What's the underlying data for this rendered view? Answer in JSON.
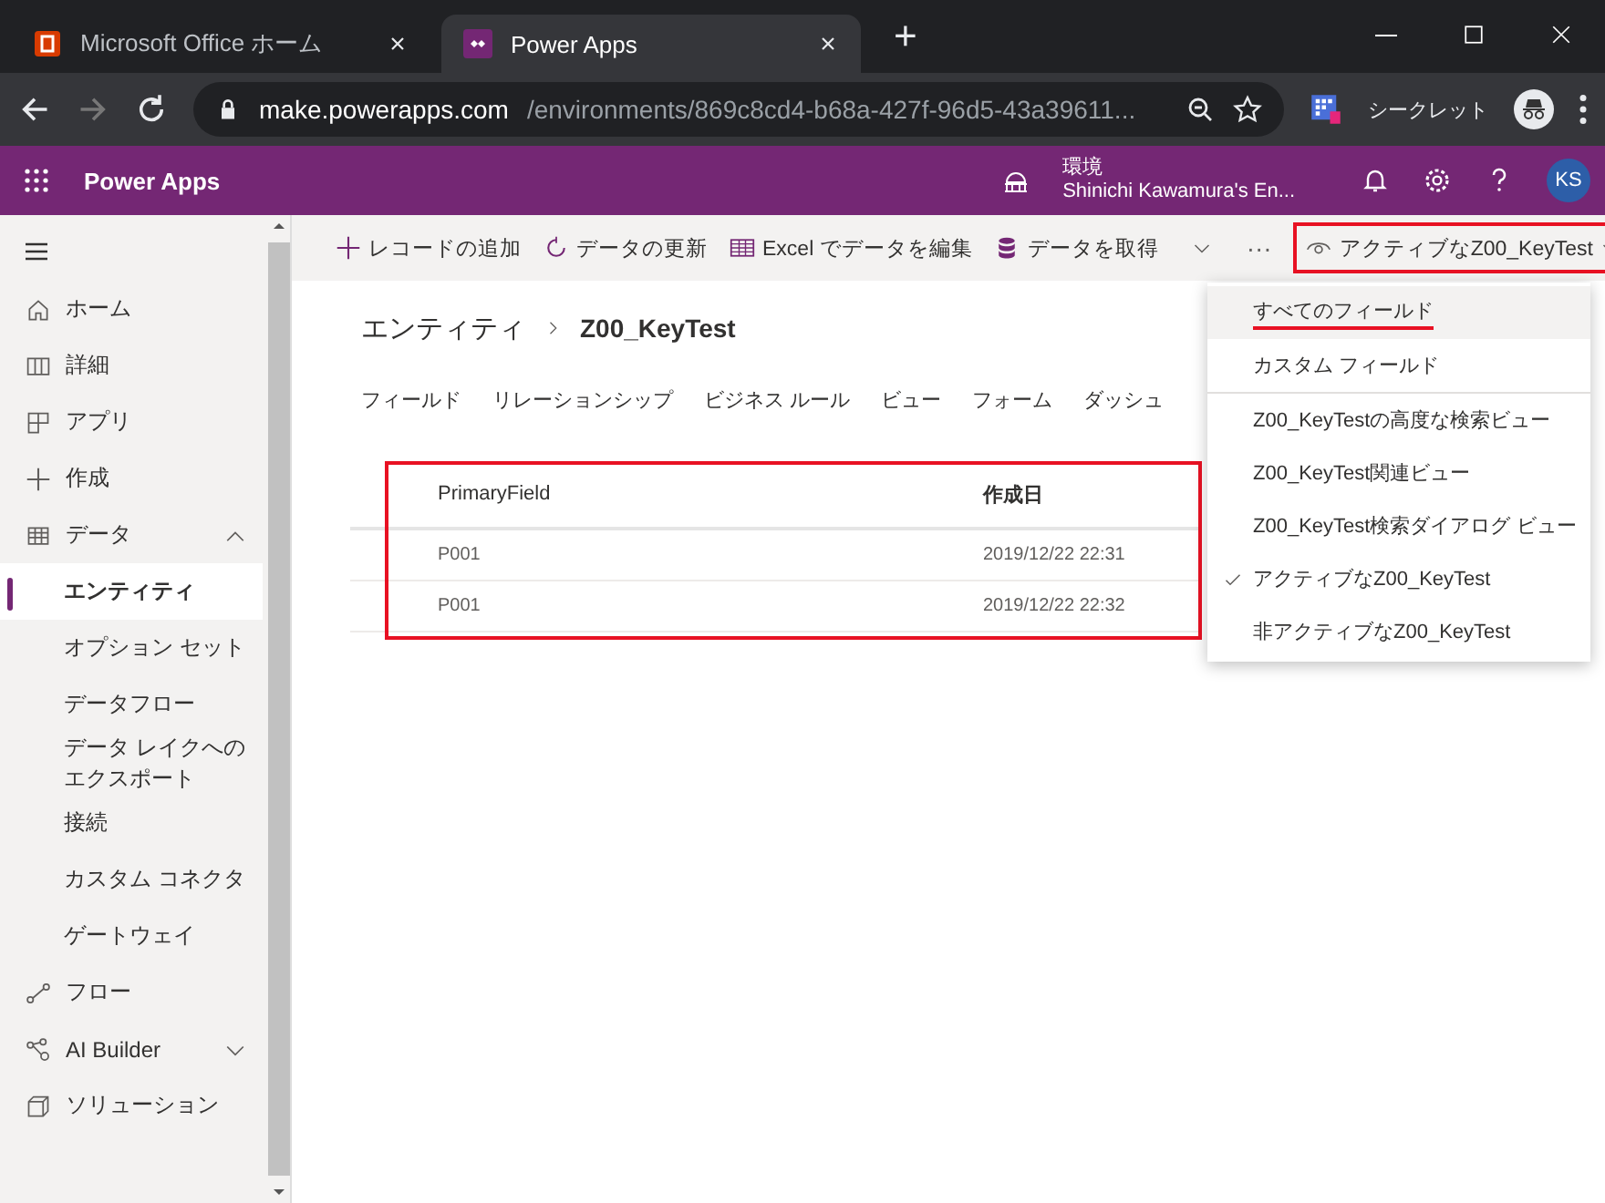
{
  "browser": {
    "tabs": [
      {
        "title": "Microsoft Office ホーム",
        "selected": false,
        "kind": "office"
      },
      {
        "title": "Power Apps",
        "selected": true,
        "kind": "powerapps"
      }
    ],
    "new_tab": "+",
    "url_host": "make.powerapps.com",
    "url_path": "/environments/869c8cd4-b68a-427f-96d5-43a39611...",
    "profile": "シークレット"
  },
  "app_header": {
    "title": "Power Apps",
    "environment_label": "環境",
    "environment": "Shinichi Kawamura's En...",
    "avatar": "KS"
  },
  "sidebar": {
    "items": [
      {
        "label": "ホーム",
        "kind": "home"
      },
      {
        "label": "詳細",
        "kind": "book"
      },
      {
        "label": "アプリ",
        "kind": "apps"
      },
      {
        "label": "作成",
        "kind": "plus"
      },
      {
        "label": "データ",
        "kind": "table",
        "expanded": true,
        "children": [
          {
            "label": "エンティティ",
            "selected": true
          },
          {
            "label": "オプション セット",
            "selected": false
          },
          {
            "label": "データフロー",
            "selected": false
          },
          {
            "label": "データ レイクへのエクスポート",
            "selected": false
          },
          {
            "label": "接続",
            "selected": false
          },
          {
            "label": "カスタム コネクタ",
            "selected": false
          },
          {
            "label": "ゲートウェイ",
            "selected": false
          }
        ]
      },
      {
        "label": "フロー",
        "kind": "flow"
      },
      {
        "label": "AI Builder",
        "kind": "ai",
        "expanded": false
      },
      {
        "label": "ソリューション",
        "kind": "solution"
      }
    ]
  },
  "command_bar": {
    "commands": [
      {
        "label": "レコードの追加",
        "kind": "plus"
      },
      {
        "label": "データの更新",
        "kind": "refresh"
      },
      {
        "label": "Excel でデータを編集",
        "kind": "excel"
      },
      {
        "label": "データを取得",
        "kind": "database"
      }
    ],
    "more": "···",
    "view_button": {
      "label": "アクティブなZ00_KeyTest",
      "highlighted": true
    }
  },
  "breadcrumb": [
    "エンティティ",
    "Z00_KeyTest"
  ],
  "tabs": [
    {
      "label": "フィールド",
      "selected": false
    },
    {
      "label": "リレーションシップ",
      "selected": false
    },
    {
      "label": "ビジネス ルール",
      "selected": false
    },
    {
      "label": "ビュー",
      "selected": false
    },
    {
      "label": "フォーム",
      "selected": false
    },
    {
      "label": "ダッシュ",
      "selected": false
    }
  ],
  "table": {
    "highlighted": true,
    "columns": [
      "PrimaryField",
      "作成日"
    ],
    "rows": [
      [
        "P001",
        "2019/12/22 22:31"
      ],
      [
        "P001",
        "2019/12/22 22:32"
      ]
    ]
  },
  "view_menu": {
    "items": [
      {
        "label": "すべてのフィールド",
        "selected": true,
        "checked": false,
        "underlined": true,
        "separator_before": false
      },
      {
        "label": "カスタム フィールド",
        "selected": false,
        "checked": false,
        "underlined": false,
        "separator_before": false
      },
      {
        "label": "Z00_KeyTestの高度な検索ビュー",
        "selected": false,
        "checked": false,
        "underlined": false,
        "separator_before": true
      },
      {
        "label": "Z00_KeyTest関連ビュー",
        "selected": false,
        "checked": false,
        "underlined": false,
        "separator_before": false
      },
      {
        "label": "Z00_KeyTest検索ダイアログ ビュー",
        "selected": false,
        "checked": false,
        "underlined": false,
        "separator_before": false
      },
      {
        "label": "アクティブなZ00_KeyTest",
        "selected": false,
        "checked": true,
        "underlined": false,
        "separator_before": false
      },
      {
        "label": "非アクティブなZ00_KeyTest",
        "selected": false,
        "checked": false,
        "underlined": false,
        "separator_before": false
      }
    ]
  }
}
